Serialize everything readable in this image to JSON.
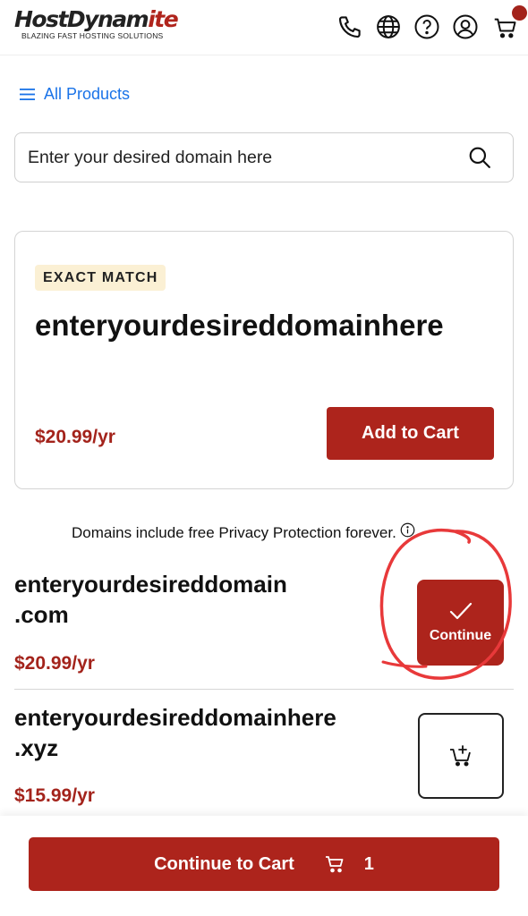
{
  "header": {
    "logo_main": "HostDynam",
    "logo_accent": "ite",
    "logo_tagline": "BLAZING FAST HOSTING SOLUTIONS",
    "icons": [
      "phone-icon",
      "globe-icon",
      "help-icon",
      "account-icon",
      "cart-icon"
    ]
  },
  "nav": {
    "all_products": "All Products"
  },
  "search": {
    "placeholder": "Enter your desired domain here"
  },
  "exact_match": {
    "badge": "EXACT MATCH",
    "domain": "enteryourdesireddomainhere",
    "price": "$20.99/yr",
    "add_to_cart": "Add to Cart"
  },
  "privacy_note": "Domains include free Privacy Protection forever.",
  "results": [
    {
      "name_line1": "enteryourdesireddomain",
      "name_line2": ".com",
      "price": "$20.99/yr",
      "action": "Continue"
    },
    {
      "name_line1": "enteryourdesireddomainhere",
      "name_line2": ".xyz",
      "price": "$15.99/yr"
    }
  ],
  "bottom_bar": {
    "label": "Continue to Cart",
    "cart_count": "1"
  },
  "colors": {
    "brand_red": "#ad241c",
    "price_red": "#a3231b",
    "link_blue": "#1a73e8",
    "badge_bg": "#fbf0d4",
    "annotation_red": "#e8393a"
  }
}
